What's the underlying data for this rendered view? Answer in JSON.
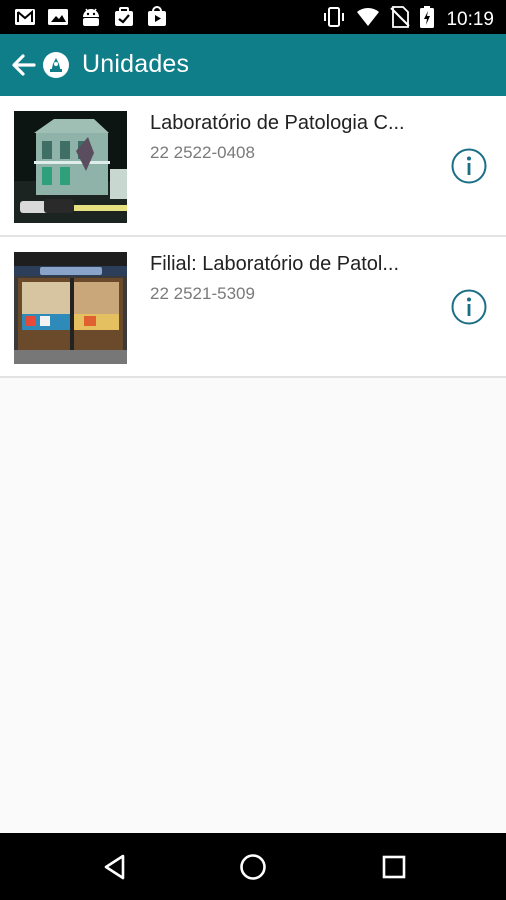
{
  "status_bar": {
    "time": "10:19",
    "left_icons": [
      "gmail-icon",
      "gallery-icon",
      "android-icon",
      "task-icon",
      "play-store-icon"
    ],
    "right_icons": [
      "vibrate-icon",
      "wifi-icon",
      "no-sim-icon",
      "battery-charging-icon"
    ]
  },
  "app_bar": {
    "title": "Unidades",
    "color": "#0f7e88",
    "back_icon": "arrow-back-icon",
    "logo_icon": "app-logo-icon"
  },
  "units": [
    {
      "title": "Laboratório de Patologia C...",
      "phone": "22 2522-0408",
      "thumbnail": "building-photo"
    },
    {
      "title": "Filial: Laboratório de Patol...",
      "phone": "22 2521-5309",
      "thumbnail": "storefront-photo"
    }
  ],
  "nav_bar": {
    "buttons": [
      "back-triangle-icon",
      "home-circle-icon",
      "recents-square-icon"
    ]
  }
}
